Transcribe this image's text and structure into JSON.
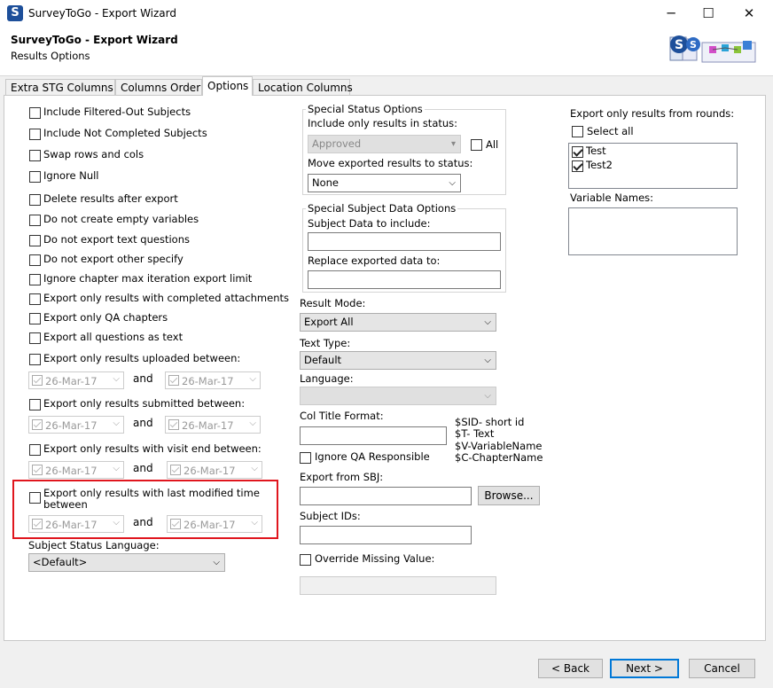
{
  "window": {
    "title": "SurveyToGo - Export Wizard",
    "app_icon_letter": "S",
    "minimize": "─",
    "maximize": "☐",
    "close": "✕"
  },
  "header": {
    "title": "SurveyToGo - Export Wizard",
    "subtitle": "Results Options"
  },
  "tabs": [
    {
      "label": "Extra STG Columns"
    },
    {
      "label": "Columns Order"
    },
    {
      "label": "Options"
    },
    {
      "label": "Location Columns"
    }
  ],
  "left": {
    "checks": [
      {
        "label": "Include Filtered-Out Subjects"
      },
      {
        "label": "Include Not Completed Subjects"
      },
      {
        "label": "Swap rows and cols"
      },
      {
        "label": "Ignore Null"
      },
      {
        "label": "Delete results after export"
      },
      {
        "label": "Do not create empty variables"
      },
      {
        "label": "Do not export text questions"
      },
      {
        "label": "Do not export other specify"
      },
      {
        "label": "Ignore chapter max iteration export limit"
      },
      {
        "label": "Export only results with completed attachments"
      },
      {
        "label": "Export only QA chapters"
      },
      {
        "label": "Export all questions as text"
      }
    ],
    "uploaded": {
      "label": "Export only results uploaded between:",
      "from": "26-Mar-17",
      "and": "and",
      "to": "26-Mar-17"
    },
    "submitted": {
      "label": "Export only results submitted between:",
      "from": "26-Mar-17",
      "and": "and",
      "to": "26-Mar-17"
    },
    "visit_end": {
      "label": "Export only results with visit end between:",
      "from": "26-Mar-17",
      "and": "and",
      "to": "26-Mar-17"
    },
    "modified": {
      "label_line1": "Export only results with last modified time",
      "label_line2": "between",
      "from": "26-Mar-17",
      "and": "and",
      "to": "26-Mar-17"
    },
    "status_language": {
      "label": "Subject Status Language:",
      "value": "<Default>"
    }
  },
  "middle": {
    "special_status": {
      "title": "Special Status Options",
      "include_label": "Include only results in status:",
      "include_value": "Approved",
      "all_label": "All",
      "move_label": "Move exported results to status:",
      "move_value": "None"
    },
    "special_subject": {
      "title": "Special Subject Data Options",
      "subject_label": "Subject Data to include:",
      "replace_label": "Replace exported data to:"
    },
    "result_mode": {
      "label": "Result Mode:",
      "value": "Export All"
    },
    "text_type": {
      "label": "Text Type:",
      "value": "Default"
    },
    "language": {
      "label": "Language:",
      "value": ""
    },
    "col_title": {
      "label": "Col Title Format:",
      "hint1": "$SID- short id",
      "hint2": "$T- Text",
      "hint3": "$V-VariableName",
      "hint4": "$C-ChapterName"
    },
    "ignore_qa": {
      "label": "Ignore QA Responsible"
    },
    "export_sbj": {
      "label": "Export from SBJ:",
      "browse": "Browse..."
    },
    "subject_ids": {
      "label": "Subject IDs:"
    },
    "override": {
      "label": "Override Missing Value:"
    }
  },
  "right": {
    "rounds_label": "Export only results from rounds:",
    "select_all": "Select all",
    "rounds": [
      {
        "label": "Test",
        "checked": true
      },
      {
        "label": "Test2",
        "checked": true
      }
    ],
    "variable_names_label": "Variable Names:"
  },
  "footer": {
    "back": "< Back",
    "next": "Next >",
    "cancel": "Cancel"
  },
  "colors": {
    "highlight": "#e0161e",
    "default_button_border": "#0078d7"
  }
}
